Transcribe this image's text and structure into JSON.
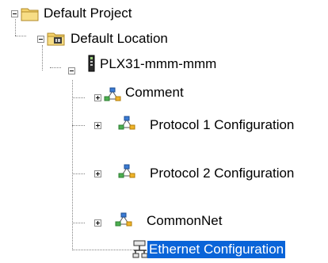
{
  "tree": {
    "root": {
      "label": "Default Project",
      "icon": "folder-icon"
    },
    "location": {
      "label": "Default Location",
      "icon": "folder-location-icon"
    },
    "device": {
      "label": "PLX31-mmm-mmm",
      "icon": "device-module-icon"
    },
    "children": [
      {
        "label": "Comment",
        "icon": "network-config-icon"
      },
      {
        "label": "Protocol 1 Configuration",
        "icon": "network-config-icon"
      },
      {
        "label": "Protocol 2 Configuration",
        "icon": "network-config-icon"
      },
      {
        "label": "CommonNet",
        "icon": "network-config-icon"
      },
      {
        "label": "Ethernet Configuration",
        "icon": "ethernet-config-icon",
        "selected": true
      }
    ]
  }
}
